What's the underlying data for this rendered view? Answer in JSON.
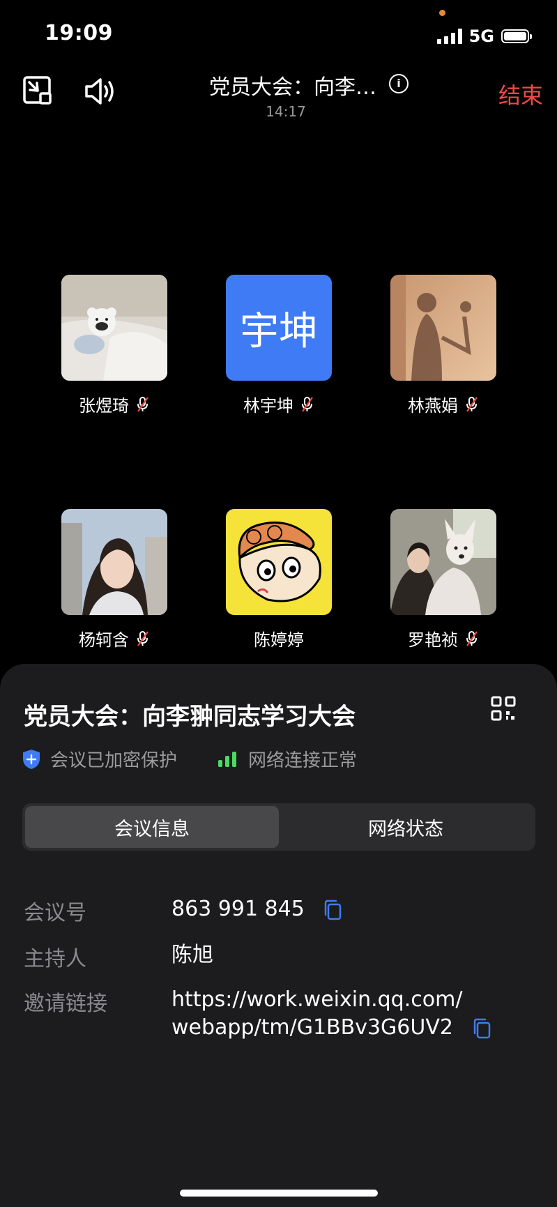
{
  "status_bar": {
    "time": "19:09",
    "network": "5G"
  },
  "header": {
    "title": "党员大会：向李…",
    "timer": "14:17",
    "end_label": "结束",
    "info_glyph": "i",
    "icons": [
      "minimize-window-icon",
      "speaker-icon",
      "info-icon"
    ]
  },
  "participants": [
    {
      "name": "张煜琦",
      "avatar_kind": "photo-bear"
    },
    {
      "name": "林宇坤",
      "avatar_kind": "text",
      "avatar_text": "宇坤",
      "avatar_color": "#3f7bf4"
    },
    {
      "name": "林燕娟",
      "avatar_kind": "photo-shadow"
    },
    {
      "name": "杨轲含",
      "avatar_kind": "photo-girl"
    },
    {
      "name": "陈婷婷",
      "avatar_kind": "cartoon"
    },
    {
      "name": "罗艳祯",
      "avatar_kind": "photo-dog"
    }
  ],
  "sheet": {
    "title": "党员大会：向李翀同志学习大会",
    "encrypted_label": "会议已加密保护",
    "network_label": "网络连接正常",
    "tabs": [
      {
        "label": "会议信息",
        "active": true
      },
      {
        "label": "网络状态",
        "active": false
      }
    ],
    "info": {
      "meeting_id_label": "会议号",
      "meeting_id": "863 991 845",
      "host_label": "主持人",
      "host": "陈旭",
      "link_label": "邀请链接",
      "link_line1": "https://work.weixin.qq.com/",
      "link_line2": "webapp/tm/G1BBv3G6UV2"
    }
  },
  "colors": {
    "end_red": "#ee4b45",
    "accent_blue": "#3f7bf4",
    "signal_green": "#4cd964",
    "sheet_bg": "#1c1c1e"
  }
}
